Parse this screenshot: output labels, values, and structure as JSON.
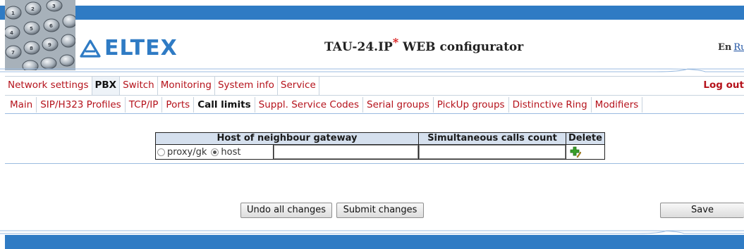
{
  "header": {
    "logo_text": "ELTEX",
    "title": "TAU-24.IP",
    "title_mark": "*",
    "title_suffix": " WEB configurator",
    "lang_en": "En",
    "lang_ru": "Ru",
    "brand_color": "#2f7bc4"
  },
  "main_nav": {
    "items": [
      "Network settings",
      "PBX",
      "Switch",
      "Monitoring",
      "System info",
      "Service"
    ],
    "active": "PBX",
    "logout": "Log out"
  },
  "sub_nav": {
    "items": [
      "Main",
      "SIP/H323 Profiles",
      "TCP/IP",
      "Ports",
      "Call limits",
      "Suppl. Service Codes",
      "Serial groups",
      "PickUp groups",
      "Distinctive Ring",
      "Modifiers"
    ],
    "active": "Call limits"
  },
  "table": {
    "headers": [
      "Host of neighbour gateway",
      "Simultaneous calls count",
      "Delete"
    ],
    "row": {
      "radio_options": [
        "proxy/gk",
        "host"
      ],
      "selected": "host",
      "host_value": "",
      "calls_value": "",
      "action_icon": "add-icon"
    }
  },
  "buttons": {
    "undo": "Undo all changes",
    "submit": "Submit changes",
    "save": "Save"
  }
}
